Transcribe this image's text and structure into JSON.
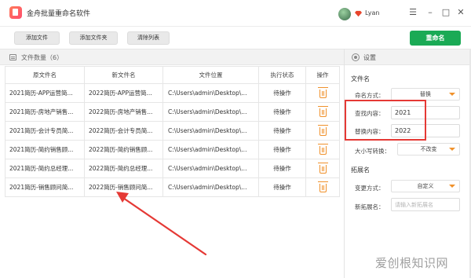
{
  "app": {
    "title": "金舟批量重命名软件",
    "user_name": "Lyan"
  },
  "window_controls": {
    "menu": "☰",
    "minimize": "–",
    "maximize": "□",
    "close": "✕"
  },
  "toolbar": {
    "add_file": "添加文件",
    "add_folder": "添加文件夹",
    "clear_list": "清除列表",
    "rename": "重命名"
  },
  "file_list": {
    "header_label": "文件数量（6）",
    "columns": [
      "原文件名",
      "新文件名",
      "文件位置",
      "执行状态",
      "操作"
    ],
    "rows": [
      {
        "old": "2021简历-APP运营简...",
        "new": "2022简历-APP运营简...",
        "path": "C:\\Users\\admin\\Desktop\\...",
        "status": "待操作"
      },
      {
        "old": "2021简历-房地产销售...",
        "new": "2022简历-房地产销售...",
        "path": "C:\\Users\\admin\\Desktop\\...",
        "status": "待操作"
      },
      {
        "old": "2021简历-会计专员简...",
        "new": "2022简历-会计专员简...",
        "path": "C:\\Users\\admin\\Desktop\\...",
        "status": "待操作"
      },
      {
        "old": "2021简历-简约销售顾...",
        "new": "2022简历-简约销售顾...",
        "path": "C:\\Users\\admin\\Desktop\\...",
        "status": "待操作"
      },
      {
        "old": "2021简历-简约总经理...",
        "new": "2022简历-简约总经理...",
        "path": "C:\\Users\\admin\\Desktop\\...",
        "status": "待操作"
      },
      {
        "old": "2021简历-销售顾问简...",
        "new": "2022简历-销售顾问简...",
        "path": "C:\\Users\\admin\\Desktop\\...",
        "status": "待操作"
      }
    ]
  },
  "settings": {
    "header_label": "设置",
    "filename_section": "文件名",
    "naming_method_label": "命名方式：",
    "naming_method_value": "替换",
    "find_label": "查找内容：",
    "find_value": "2021",
    "replace_label": "替换内容：",
    "replace_value": "2022",
    "case_label": "大小写转换：",
    "case_value": "不改变",
    "extension_section": "拓展名",
    "change_method_label": "变更方式：",
    "change_method_value": "自定义",
    "new_ext_label": "新拓展名：",
    "new_ext_placeholder": "请输入新拓展名"
  },
  "annotation": {
    "highlight_color": "#e53935"
  },
  "watermark": "爱创根知识网",
  "colors": {
    "accent_green": "#1aaa55",
    "accent_orange": "#f0912b"
  }
}
